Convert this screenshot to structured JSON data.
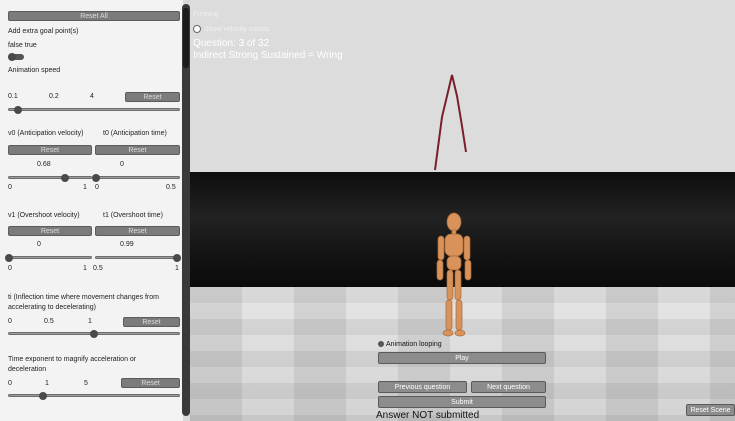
{
  "panel": {
    "reset_all": "Reset All",
    "extra_goal": "Add extra goal point(s)",
    "false_true": "false true",
    "anim_speed": {
      "label": "Animation speed",
      "ticks": [
        "0.1",
        "0.2",
        "4"
      ],
      "reset": "Reset",
      "value_fraction": 0.05
    },
    "v0": {
      "label": "v0 (Anticipation velocity)",
      "reset": "Reset",
      "value": "0.68",
      "min": "0",
      "max": "1",
      "value_fraction": 0.68
    },
    "t0": {
      "label": "t0 (Anticipation time)",
      "reset": "Reset",
      "value": "0",
      "min": "0",
      "max": "0.5",
      "value_fraction": 0.0
    },
    "v1": {
      "label": "v1 (Overshoot velocity)",
      "reset": "Reset",
      "value": "0",
      "min": "0",
      "max": "1",
      "value_fraction": 0.0
    },
    "t1": {
      "label": "t1 (Overshoot time)",
      "reset": "Reset",
      "value": "0.99",
      "min": "0.5",
      "max": "1",
      "value_fraction": 0.98
    },
    "ti": {
      "label_line1": "ti (Inflection time where movement changes from",
      "label_line2": "accelerating to decelerating)",
      "ticks": [
        "0",
        "0.5",
        "1"
      ],
      "reset": "Reset",
      "value_fraction": 0.5
    },
    "time_exp": {
      "label_line1": "Time exponent to magnify acceleration or",
      "label_line2": "deceleration",
      "ticks": [
        "0",
        "1",
        "5"
      ],
      "reset": "Reset",
      "value_fraction": 0.2
    }
  },
  "viewport": {
    "mode": "Forming",
    "show_velocity": "Show velocity curves",
    "question": "Question: 3 of 32",
    "answer_label": "Indirect Strong Sustained  = Wring",
    "animation_looping": "Animation looping",
    "play": "Play",
    "previous_question": "Previous question",
    "next_question": "Next question",
    "submit": "Submit",
    "status": "Answer NOT submitted",
    "reset_scene": "Reset Scene"
  },
  "colors": {
    "curve": "#7a1f2a",
    "figure": "#d9935a"
  }
}
